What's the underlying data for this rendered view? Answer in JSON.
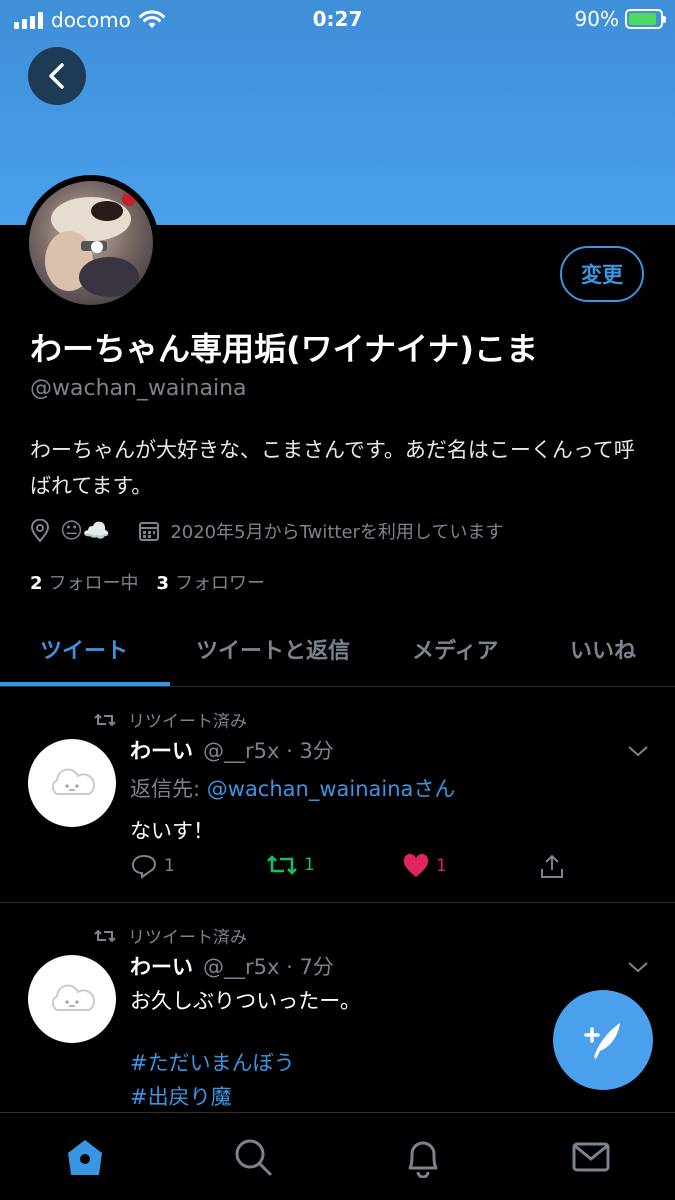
{
  "status_bar": {
    "carrier": "docomo",
    "time": "0:27",
    "battery_percent_label": "90%",
    "battery_level": 0.9
  },
  "profile": {
    "display_name": "わーちゃん専用垢(ワイナイナ)こま",
    "handle": "@wachan_wainaina",
    "bio": "わーちゃんが大好きな、こまさんです。あだ名はこーくんって呼ばれてます。",
    "location_emoji": "😐☁️",
    "joined": "2020年5月からTwitterを利用しています",
    "edit_label": "変更",
    "following_count": "2",
    "following_label": "フォロー中",
    "followers_count": "3",
    "followers_label": "フォロワー"
  },
  "tabs": [
    {
      "label": "ツイート",
      "active": true
    },
    {
      "label": "ツイートと返信",
      "active": false
    },
    {
      "label": "メディア",
      "active": false
    },
    {
      "label": "いいね",
      "active": false
    }
  ],
  "tweets": [
    {
      "retweet_label": "リツイート済み",
      "name": "わーい",
      "meta": "@__r5x · 3分",
      "reply_prefix": "返信先: ",
      "reply_handle": "@wachan_wainainaさん",
      "text": "ないす！",
      "reply_count": "1",
      "retweet_count": "1",
      "like_count": "1"
    },
    {
      "retweet_label": "リツイート済み",
      "name": "わーい",
      "meta": "@__r5x · 7分",
      "text": "お久しぶりついったー。",
      "hashtag1": "#ただいまんぼう",
      "hashtag2": "#出戻り魔"
    }
  ],
  "colors": {
    "accent": "#3a95e2",
    "retweet": "#17bf63",
    "like": "#e0245e",
    "muted": "#7a8490",
    "background": "#000000"
  },
  "icons": {
    "back": "arrow-left-icon",
    "location": "location-pin-icon",
    "calendar": "calendar-icon",
    "retweet": "retweet-icon",
    "reply": "reply-icon",
    "like": "heart-icon",
    "share": "share-icon",
    "compose": "compose-icon",
    "home": "home-icon",
    "search": "search-icon",
    "notifications": "bell-icon",
    "messages": "mail-icon"
  }
}
